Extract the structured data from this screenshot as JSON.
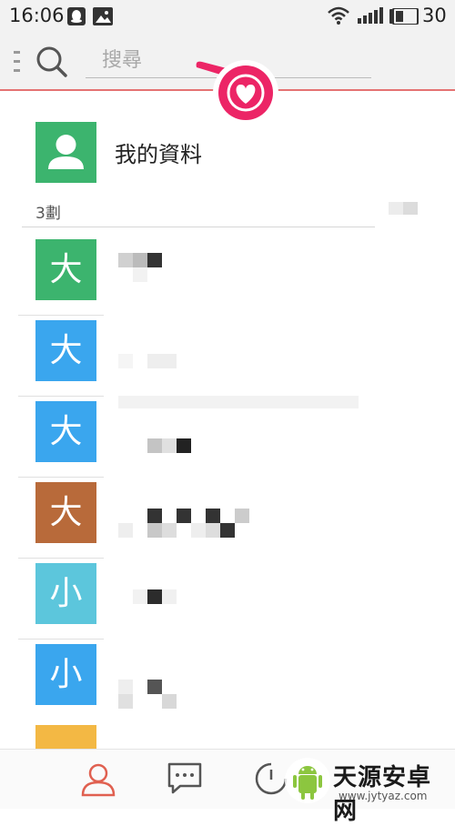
{
  "status_bar": {
    "time": "16:06",
    "battery_text": "30",
    "icons": [
      "qq-icon",
      "image-icon",
      "wifi-icon",
      "signal-icon",
      "battery-icon"
    ]
  },
  "search": {
    "placeholder": "搜尋",
    "value": ""
  },
  "profile": {
    "label": "我的資料",
    "avatar_color": "#3cb46e"
  },
  "section": {
    "label": "3劃"
  },
  "contacts": [
    {
      "initial": "大",
      "color": "#3cb46e"
    },
    {
      "initial": "大",
      "color": "#3aa6ee"
    },
    {
      "initial": "大",
      "color": "#3aa6ee"
    },
    {
      "initial": "大",
      "color": "#b86a3a"
    },
    {
      "initial": "小",
      "color": "#5cc6dc"
    },
    {
      "initial": "小",
      "color": "#3aa6ee"
    },
    {
      "initial": "",
      "color": "#f3b844"
    }
  ],
  "bottom_nav": {
    "tabs": [
      "contacts-tab",
      "messages-tab",
      "recent-calls-tab"
    ],
    "active_color": "#e06050",
    "icon_color": "#555555"
  },
  "watermark": {
    "title": "天源安卓网",
    "url": "www.jytyaz.com"
  },
  "colors": {
    "header_bg": "#f2f2f2",
    "header_border": "#e57373",
    "heart_badge": "#ec2566"
  }
}
